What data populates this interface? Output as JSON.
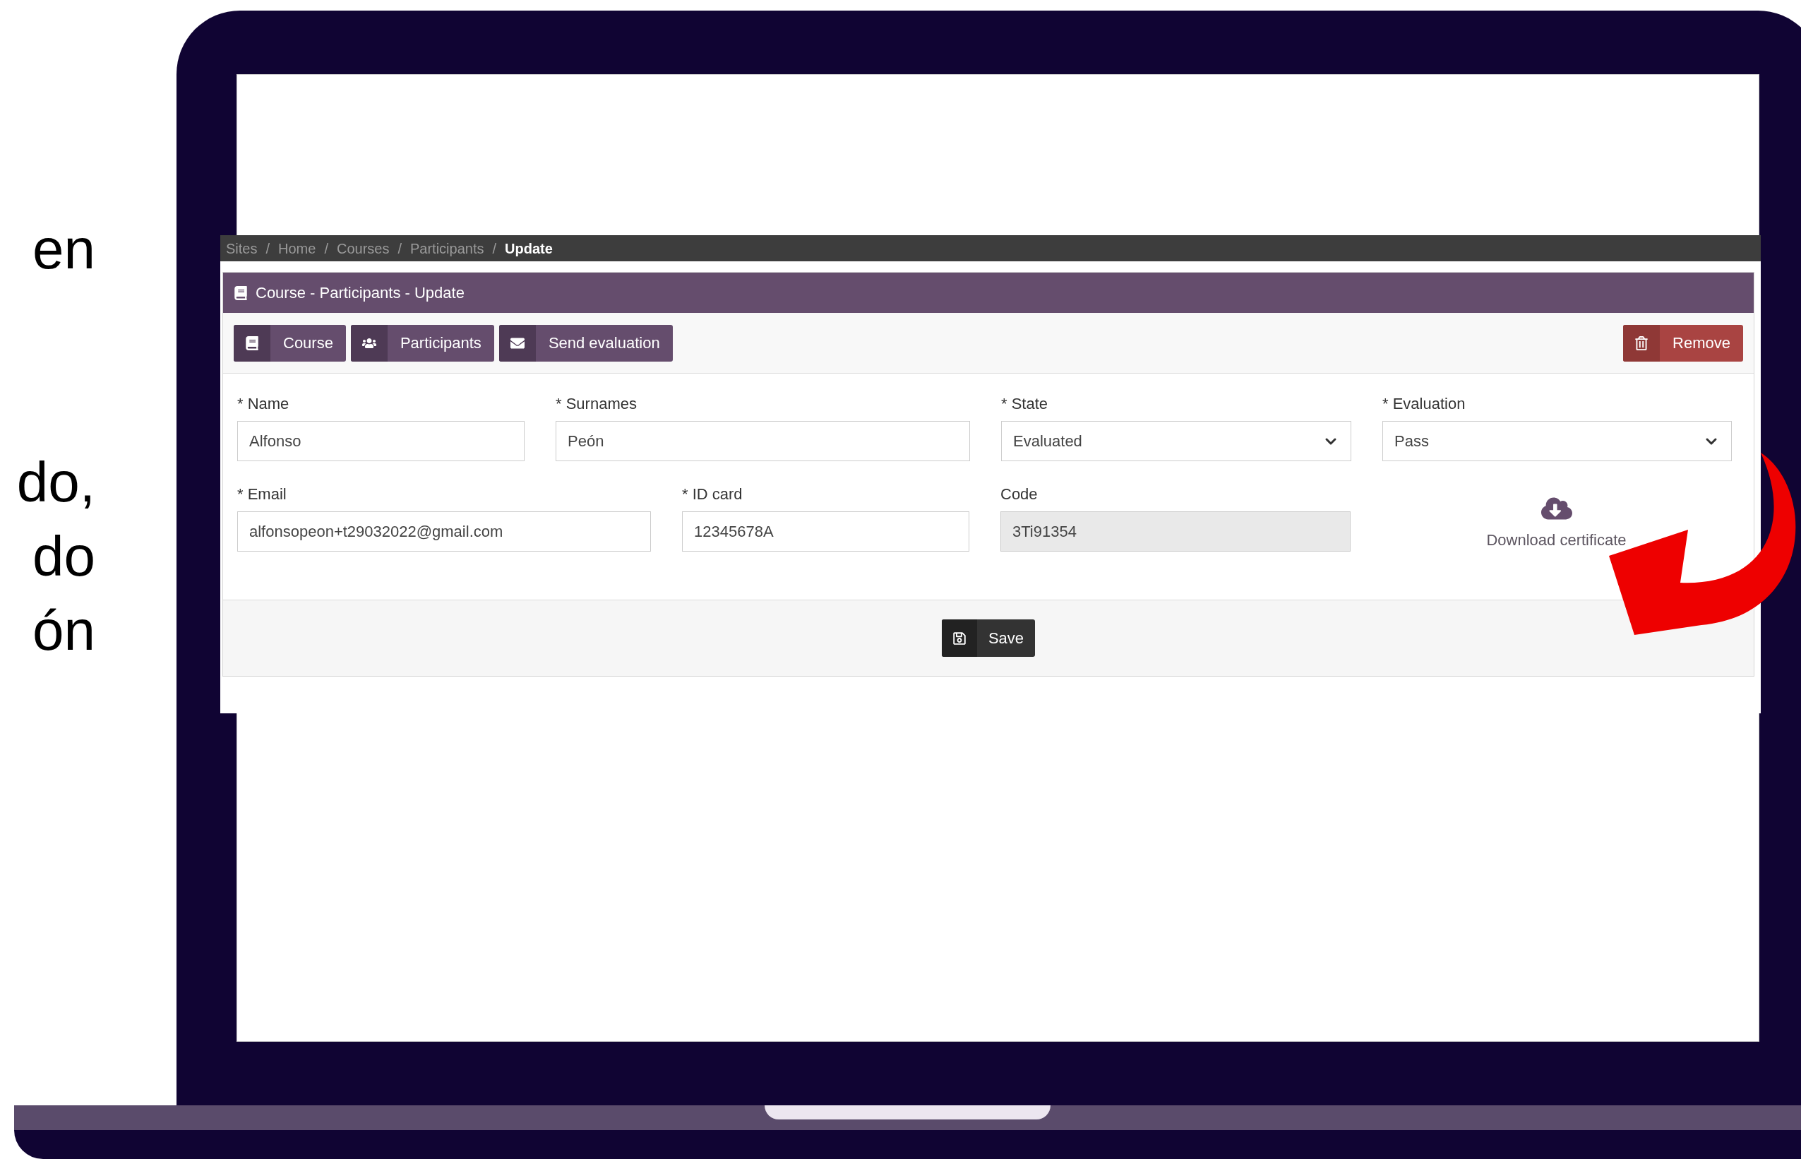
{
  "side_text": [
    "en",
    "do,",
    "do",
    "ón"
  ],
  "breadcrumb": [
    {
      "label": "Sites",
      "selected": false
    },
    {
      "separator": "/",
      "label": "Home",
      "selected": false
    },
    {
      "separator": "/",
      "label": "Courses",
      "selected": false
    },
    {
      "separator": "/",
      "label": "Participants",
      "selected": false
    },
    {
      "separator": "/",
      "label": "Update",
      "selected": true
    }
  ],
  "panel": {
    "title": "Course - Participants - Update"
  },
  "toolbar": [
    {
      "label": "Course",
      "kind": "nav"
    },
    {
      "label": "Participants",
      "kind": "nav"
    },
    {
      "label": "Send evaluation",
      "kind": "nav"
    },
    {
      "label": "Remove",
      "kind": "danger"
    }
  ],
  "rows": [
    [
      {
        "label": "* Name",
        "value": "Alfonso",
        "kind": "text",
        "disabled": false
      },
      {
        "label": "* Surnames",
        "value": "Peón",
        "kind": "text",
        "disabled": false
      },
      {
        "label": "* State",
        "value": "Evaluated",
        "kind": "select",
        "disabled": false
      },
      {
        "label": "* Evaluation",
        "value": "Pass",
        "kind": "select",
        "disabled": false
      }
    ],
    [
      {
        "label": "* Email",
        "value": "alfonsopeon+t29032022@gmail.com",
        "kind": "text",
        "disabled": false
      },
      {
        "label": "* ID card",
        "value": "12345678A",
        "kind": "text",
        "disabled": false
      },
      {
        "label": "Code",
        "value": "3Ti91354",
        "kind": "text",
        "disabled": true
      },
      {
        "label": "Download certificate",
        "kind": "download"
      }
    ]
  ],
  "save": {
    "label": "Save"
  }
}
